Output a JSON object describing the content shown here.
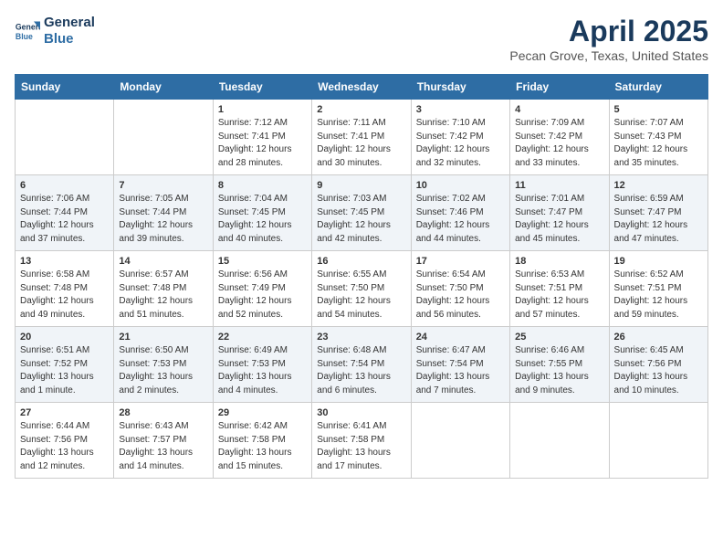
{
  "header": {
    "logo_line1": "General",
    "logo_line2": "Blue",
    "month_title": "April 2025",
    "location": "Pecan Grove, Texas, United States"
  },
  "days_of_week": [
    "Sunday",
    "Monday",
    "Tuesday",
    "Wednesday",
    "Thursday",
    "Friday",
    "Saturday"
  ],
  "weeks": [
    [
      {
        "day": "",
        "info": ""
      },
      {
        "day": "",
        "info": ""
      },
      {
        "day": "1",
        "info": "Sunrise: 7:12 AM\nSunset: 7:41 PM\nDaylight: 12 hours and 28 minutes."
      },
      {
        "day": "2",
        "info": "Sunrise: 7:11 AM\nSunset: 7:41 PM\nDaylight: 12 hours and 30 minutes."
      },
      {
        "day": "3",
        "info": "Sunrise: 7:10 AM\nSunset: 7:42 PM\nDaylight: 12 hours and 32 minutes."
      },
      {
        "day": "4",
        "info": "Sunrise: 7:09 AM\nSunset: 7:42 PM\nDaylight: 12 hours and 33 minutes."
      },
      {
        "day": "5",
        "info": "Sunrise: 7:07 AM\nSunset: 7:43 PM\nDaylight: 12 hours and 35 minutes."
      }
    ],
    [
      {
        "day": "6",
        "info": "Sunrise: 7:06 AM\nSunset: 7:44 PM\nDaylight: 12 hours and 37 minutes."
      },
      {
        "day": "7",
        "info": "Sunrise: 7:05 AM\nSunset: 7:44 PM\nDaylight: 12 hours and 39 minutes."
      },
      {
        "day": "8",
        "info": "Sunrise: 7:04 AM\nSunset: 7:45 PM\nDaylight: 12 hours and 40 minutes."
      },
      {
        "day": "9",
        "info": "Sunrise: 7:03 AM\nSunset: 7:45 PM\nDaylight: 12 hours and 42 minutes."
      },
      {
        "day": "10",
        "info": "Sunrise: 7:02 AM\nSunset: 7:46 PM\nDaylight: 12 hours and 44 minutes."
      },
      {
        "day": "11",
        "info": "Sunrise: 7:01 AM\nSunset: 7:47 PM\nDaylight: 12 hours and 45 minutes."
      },
      {
        "day": "12",
        "info": "Sunrise: 6:59 AM\nSunset: 7:47 PM\nDaylight: 12 hours and 47 minutes."
      }
    ],
    [
      {
        "day": "13",
        "info": "Sunrise: 6:58 AM\nSunset: 7:48 PM\nDaylight: 12 hours and 49 minutes."
      },
      {
        "day": "14",
        "info": "Sunrise: 6:57 AM\nSunset: 7:48 PM\nDaylight: 12 hours and 51 minutes."
      },
      {
        "day": "15",
        "info": "Sunrise: 6:56 AM\nSunset: 7:49 PM\nDaylight: 12 hours and 52 minutes."
      },
      {
        "day": "16",
        "info": "Sunrise: 6:55 AM\nSunset: 7:50 PM\nDaylight: 12 hours and 54 minutes."
      },
      {
        "day": "17",
        "info": "Sunrise: 6:54 AM\nSunset: 7:50 PM\nDaylight: 12 hours and 56 minutes."
      },
      {
        "day": "18",
        "info": "Sunrise: 6:53 AM\nSunset: 7:51 PM\nDaylight: 12 hours and 57 minutes."
      },
      {
        "day": "19",
        "info": "Sunrise: 6:52 AM\nSunset: 7:51 PM\nDaylight: 12 hours and 59 minutes."
      }
    ],
    [
      {
        "day": "20",
        "info": "Sunrise: 6:51 AM\nSunset: 7:52 PM\nDaylight: 13 hours and 1 minute."
      },
      {
        "day": "21",
        "info": "Sunrise: 6:50 AM\nSunset: 7:53 PM\nDaylight: 13 hours and 2 minutes."
      },
      {
        "day": "22",
        "info": "Sunrise: 6:49 AM\nSunset: 7:53 PM\nDaylight: 13 hours and 4 minutes."
      },
      {
        "day": "23",
        "info": "Sunrise: 6:48 AM\nSunset: 7:54 PM\nDaylight: 13 hours and 6 minutes."
      },
      {
        "day": "24",
        "info": "Sunrise: 6:47 AM\nSunset: 7:54 PM\nDaylight: 13 hours and 7 minutes."
      },
      {
        "day": "25",
        "info": "Sunrise: 6:46 AM\nSunset: 7:55 PM\nDaylight: 13 hours and 9 minutes."
      },
      {
        "day": "26",
        "info": "Sunrise: 6:45 AM\nSunset: 7:56 PM\nDaylight: 13 hours and 10 minutes."
      }
    ],
    [
      {
        "day": "27",
        "info": "Sunrise: 6:44 AM\nSunset: 7:56 PM\nDaylight: 13 hours and 12 minutes."
      },
      {
        "day": "28",
        "info": "Sunrise: 6:43 AM\nSunset: 7:57 PM\nDaylight: 13 hours and 14 minutes."
      },
      {
        "day": "29",
        "info": "Sunrise: 6:42 AM\nSunset: 7:58 PM\nDaylight: 13 hours and 15 minutes."
      },
      {
        "day": "30",
        "info": "Sunrise: 6:41 AM\nSunset: 7:58 PM\nDaylight: 13 hours and 17 minutes."
      },
      {
        "day": "",
        "info": ""
      },
      {
        "day": "",
        "info": ""
      },
      {
        "day": "",
        "info": ""
      }
    ]
  ]
}
